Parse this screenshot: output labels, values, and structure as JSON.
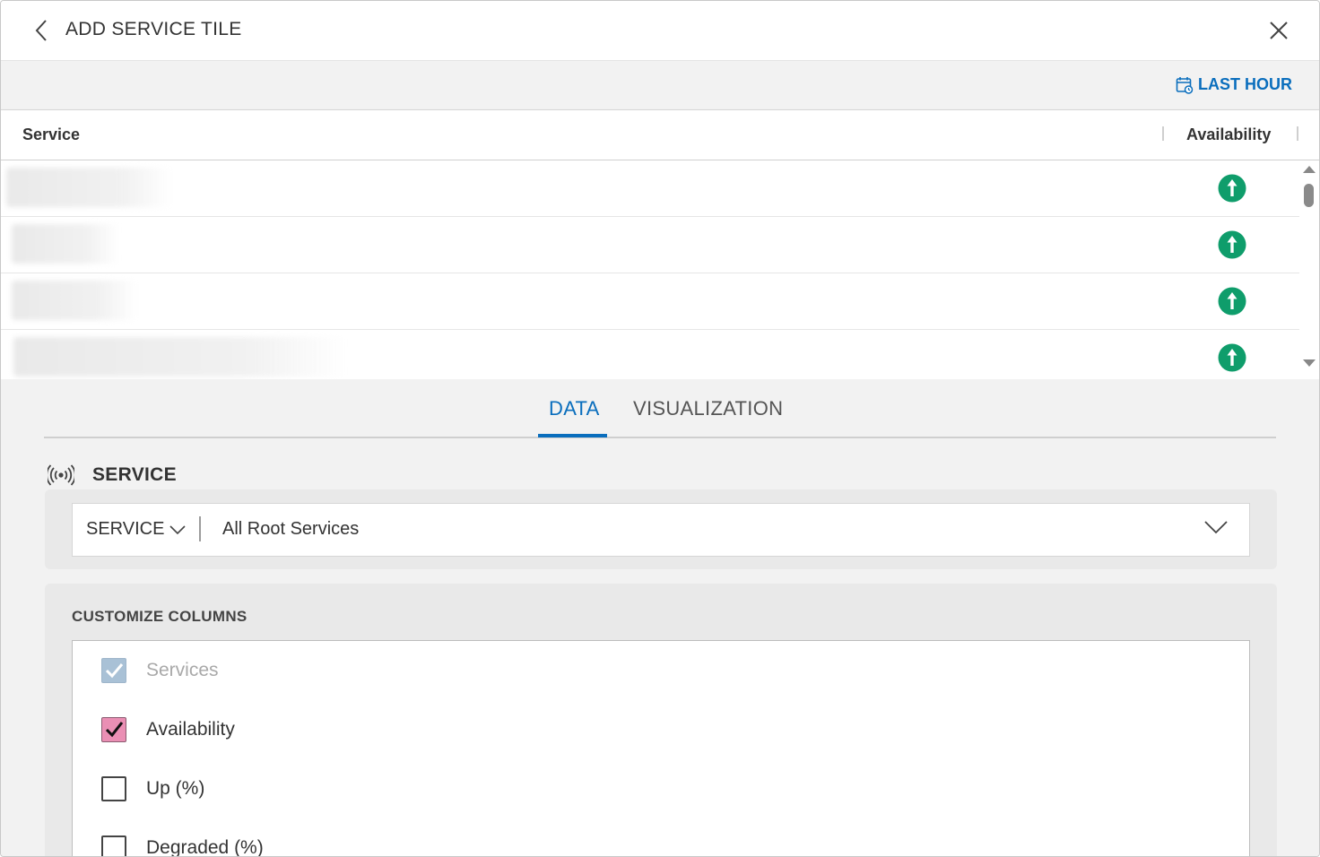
{
  "header": {
    "title": "ADD SERVICE TILE"
  },
  "toolbar": {
    "time_range_label": "LAST HOUR"
  },
  "table": {
    "columns": [
      "Service",
      "Availability"
    ],
    "rows": [
      {
        "service": "",
        "availability": "up"
      },
      {
        "service": "",
        "availability": "up"
      },
      {
        "service": "",
        "availability": "up"
      },
      {
        "service": "",
        "availability": "up"
      }
    ]
  },
  "tabs": [
    {
      "label": "DATA",
      "active": true
    },
    {
      "label": "VISUALIZATION",
      "active": false
    }
  ],
  "service_section": {
    "heading": "SERVICE",
    "selector_type": "SERVICE",
    "selected_value": "All Root Services"
  },
  "customize_columns": {
    "heading": "CUSTOMIZE COLUMNS",
    "items": [
      {
        "label": "Services",
        "checked": true,
        "disabled": true
      },
      {
        "label": "Availability",
        "checked": true,
        "disabled": false
      },
      {
        "label": "Up (%)",
        "checked": false,
        "disabled": false
      },
      {
        "label": "Degraded (%)",
        "checked": false,
        "disabled": false
      }
    ]
  },
  "colors": {
    "accent": "#0a6ebd",
    "status_up": "#0f9d6b",
    "checkbox_checked": "#ea8fb4",
    "checkbox_disabled": "#a9c1d6"
  }
}
